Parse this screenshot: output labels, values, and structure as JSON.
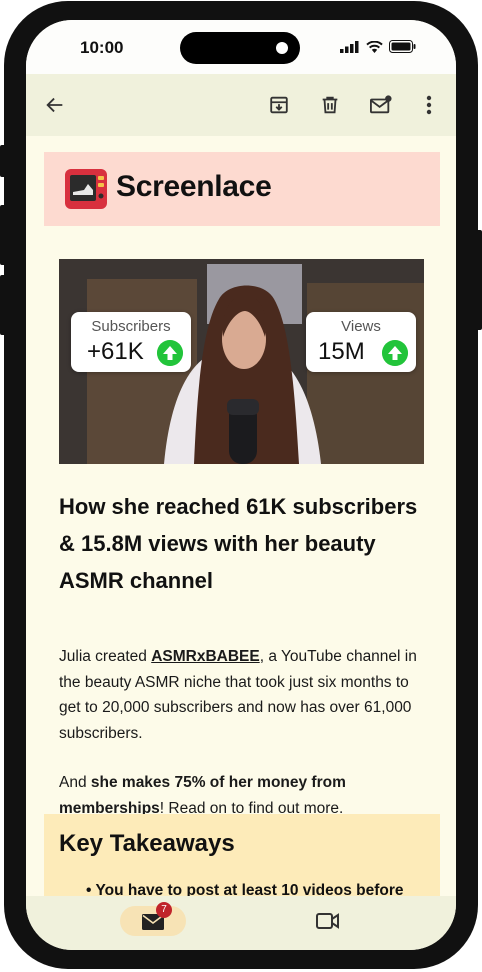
{
  "status_bar": {
    "time": "10:00"
  },
  "toolbar": {
    "back_icon": "arrow-left-icon",
    "archive_icon": "archive-icon",
    "delete_icon": "trash-icon",
    "unread_icon": "mark-unread-icon",
    "more_icon": "more-vertical-icon"
  },
  "email": {
    "brand": {
      "name": "Screenlace"
    },
    "hero": {
      "subscribers_label": "Subscribers",
      "subscribers_value": "+61K",
      "views_label": "Views",
      "views_value": "15M"
    },
    "headline": "How she reached 61K subscribers & 15.8M views with her beauty ASMR channel",
    "paragraph1": {
      "before": "Julia created ",
      "link": "ASMRxBABEE",
      "after": ", a YouTube channel in the beauty ASMR niche that took just six months to get to 20,000 subscribers and now has over 61,000 subscribers."
    },
    "paragraph2": {
      "before": "And ",
      "bold": "she makes 75% of her money from memberships",
      "after": "! Read on to find out more."
    },
    "takeaways": {
      "title": "Key Takeaways",
      "bullet1": "You have to post at least 10 videos before"
    }
  },
  "bottom_nav": {
    "mail_badge": "7"
  },
  "colors": {
    "brand_bar": "#fddad0",
    "takeaways_bg": "#fdebb9",
    "toolbar_bg": "#f0f1dc",
    "up_badge": "#22c43a",
    "notification_badge": "#c0242b"
  }
}
